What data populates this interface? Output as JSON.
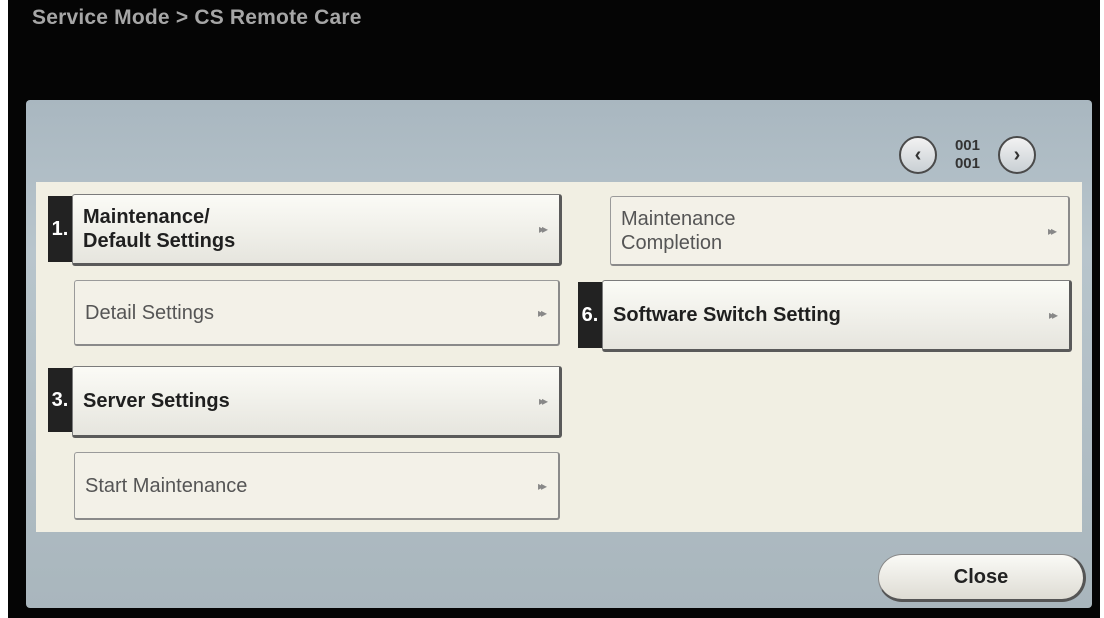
{
  "header": {
    "breadcrumb": "Service Mode > CS Remote Care"
  },
  "pager": {
    "current": "001",
    "total": "001",
    "prev_icon": "chevron-left-icon",
    "next_icon": "chevron-right-icon"
  },
  "menu": {
    "left": [
      {
        "number": "1.",
        "label_line1": "Maintenance/",
        "label_line2": "Default Settings",
        "enabled": true
      },
      {
        "number": "",
        "label": "Detail Settings",
        "enabled": false
      },
      {
        "number": "3.",
        "label": "Server Settings",
        "enabled": true
      },
      {
        "number": "",
        "label": "Start Maintenance",
        "enabled": false
      }
    ],
    "right": [
      {
        "number": "",
        "label_line1": "Maintenance",
        "label_line2": "Completion",
        "enabled": false
      },
      {
        "number": "6.",
        "label": "Software Switch Setting",
        "enabled": true
      }
    ],
    "arrow_glyph": "▸▸"
  },
  "footer": {
    "close_label": "Close"
  },
  "colors": {
    "panel": "#b8c5cc",
    "content": "#f1efe3",
    "number_tab": "#222222"
  }
}
